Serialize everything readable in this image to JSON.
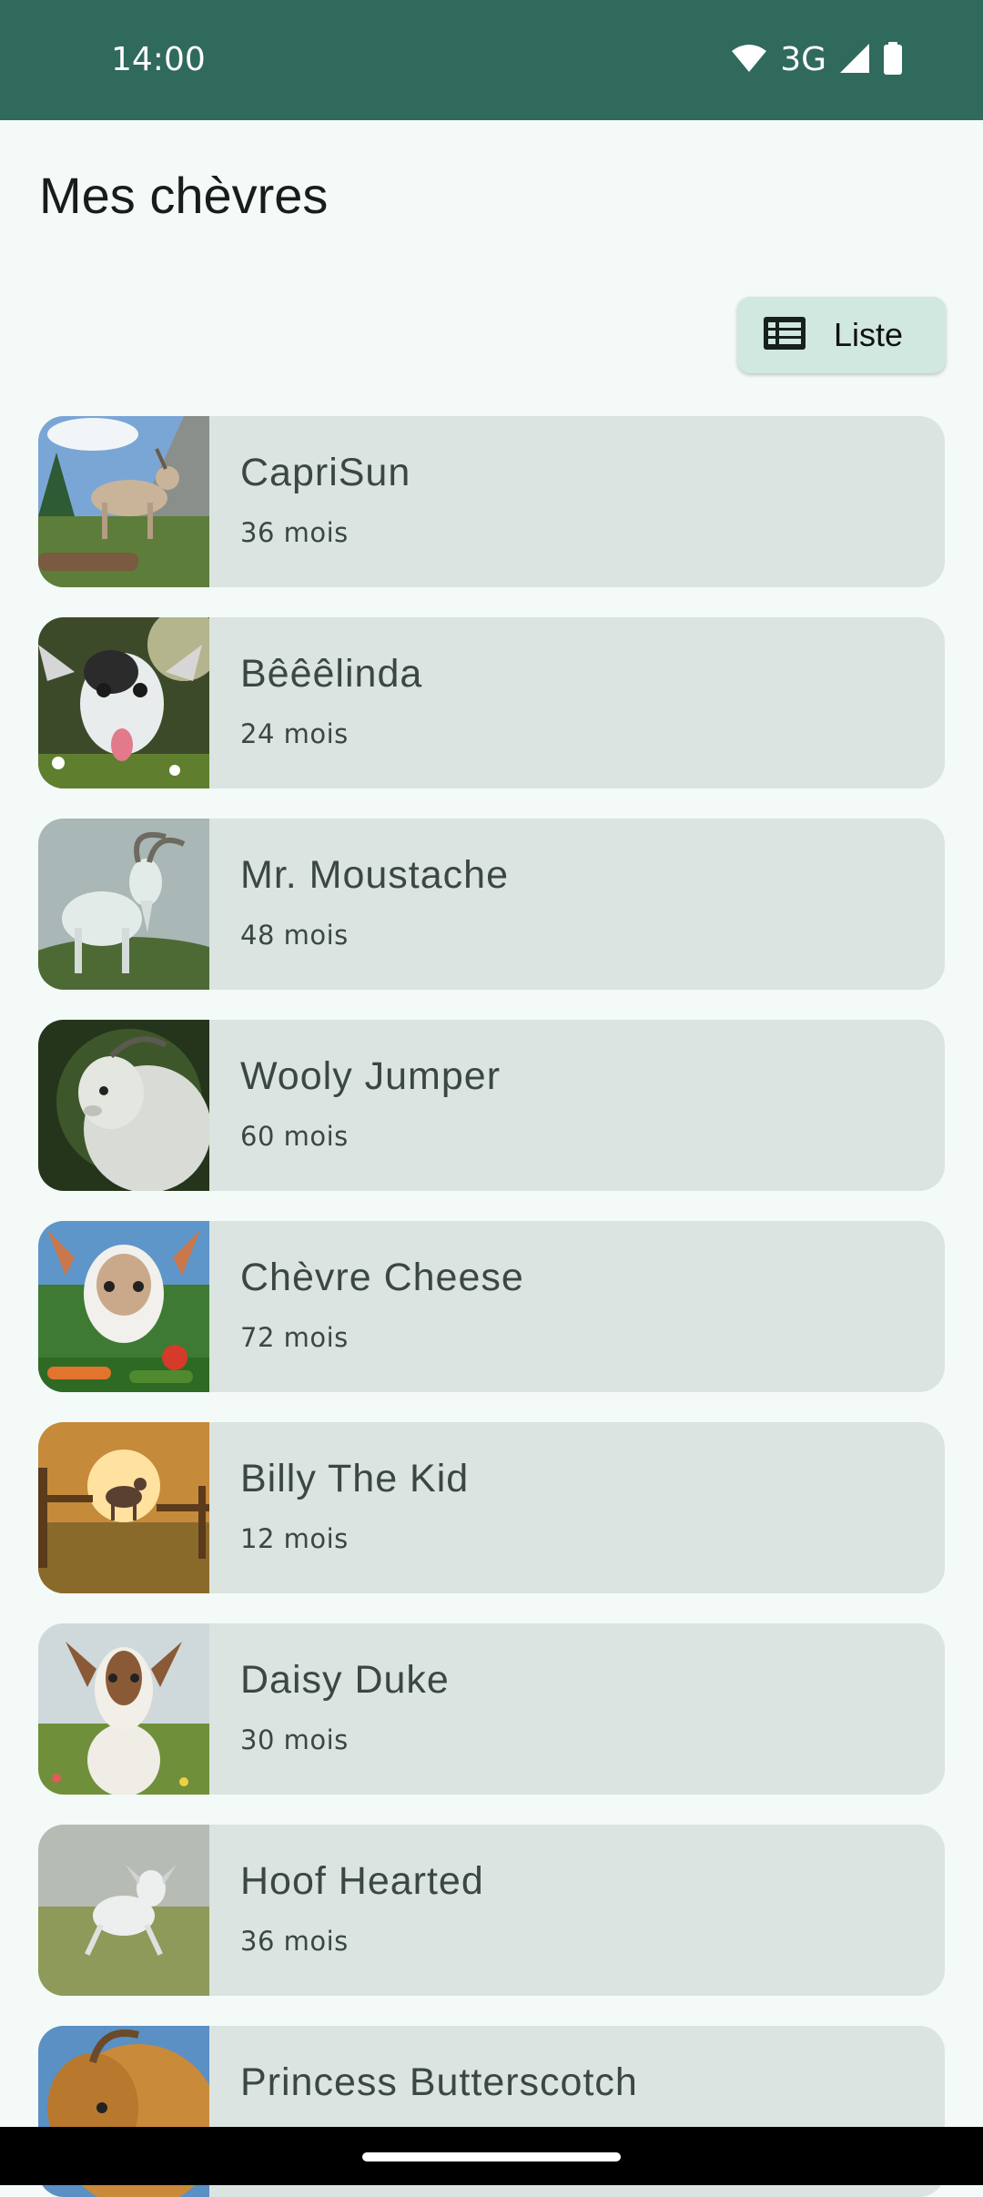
{
  "status_bar": {
    "time": "14:00",
    "network": "3G",
    "icons": [
      "wifi-icon",
      "signal-icon",
      "battery-icon"
    ]
  },
  "page": {
    "title": "Mes chèvres"
  },
  "view_toggle": {
    "label": "Liste",
    "icon": "list-view-icon"
  },
  "goats": [
    {
      "name": "CapriSun",
      "age": "36 mois",
      "image": "goat-mountain-photo"
    },
    {
      "name": "Bêêêlinda",
      "age": "24 mois",
      "image": "goat-tongue-photo"
    },
    {
      "name": "Mr. Moustache",
      "age": "48 mois",
      "image": "goat-bearded-photo"
    },
    {
      "name": "Wooly Jumper",
      "age": "60 mois",
      "image": "goat-wooly-photo"
    },
    {
      "name": "Chèvre Cheese",
      "age": "72 mois",
      "image": "goat-vegetables-photo"
    },
    {
      "name": "Billy The Kid",
      "age": "12 mois",
      "image": "goat-sunset-jump-photo"
    },
    {
      "name": "Daisy Duke",
      "age": "30 mois",
      "image": "goat-meadow-photo"
    },
    {
      "name": "Hoof Hearted",
      "age": "36 mois",
      "image": "goat-running-kid-photo"
    },
    {
      "name": "Princess Butterscotch",
      "age": "",
      "image": "goat-golden-photo"
    }
  ],
  "colors": {
    "status_bar": "#2f6a5c",
    "background": "#f4faf7",
    "card": "#dbe4e0",
    "toggle": "#d0e8e0"
  }
}
